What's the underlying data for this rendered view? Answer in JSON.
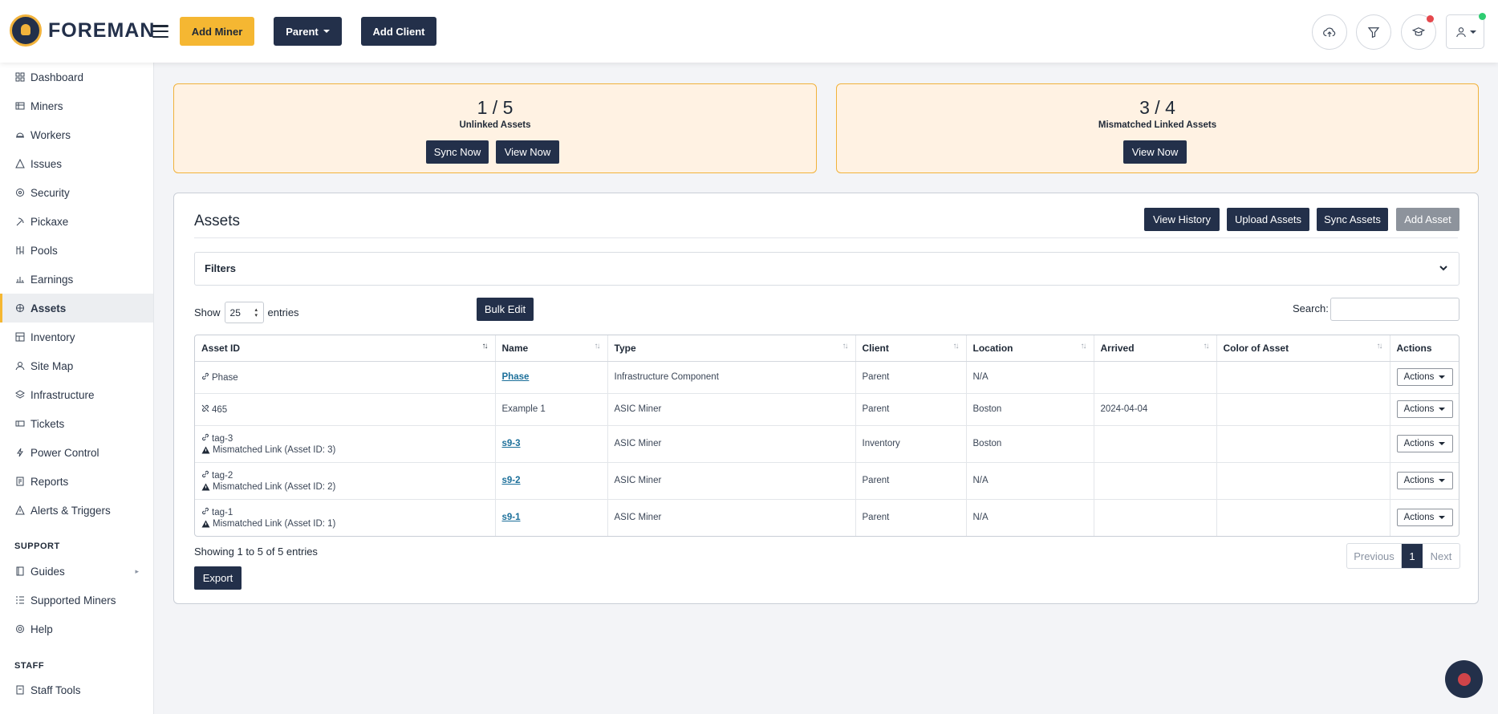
{
  "brand": {
    "name": "FOREMAN"
  },
  "header": {
    "add_miner": "Add Miner",
    "parent": "Parent",
    "add_client": "Add Client",
    "icons": [
      "cloud-upload-icon",
      "filter-icon",
      "graduation-cap-icon",
      "user-icon"
    ]
  },
  "sidebar": {
    "items": [
      {
        "label": "Dashboard",
        "icon": "dashboard-icon"
      },
      {
        "label": "Miners",
        "icon": "miners-icon"
      },
      {
        "label": "Workers",
        "icon": "workers-icon"
      },
      {
        "label": "Issues",
        "icon": "warning-icon"
      },
      {
        "label": "Security",
        "icon": "security-icon"
      },
      {
        "label": "Pickaxe",
        "icon": "pickaxe-icon"
      },
      {
        "label": "Pools",
        "icon": "pools-icon"
      },
      {
        "label": "Earnings",
        "icon": "earnings-icon"
      },
      {
        "label": "Assets",
        "icon": "assets-icon"
      },
      {
        "label": "Inventory",
        "icon": "inventory-icon"
      },
      {
        "label": "Site Map",
        "icon": "site-map-icon"
      },
      {
        "label": "Infrastructure",
        "icon": "layers-icon"
      },
      {
        "label": "Tickets",
        "icon": "ticket-icon"
      },
      {
        "label": "Power Control",
        "icon": "bolt-icon"
      },
      {
        "label": "Reports",
        "icon": "report-icon"
      },
      {
        "label": "Alerts & Triggers",
        "icon": "alert-icon"
      }
    ],
    "support_heading": "SUPPORT",
    "support_items": [
      {
        "label": "Guides",
        "icon": "book-icon"
      },
      {
        "label": "Supported Miners",
        "icon": "list-icon"
      },
      {
        "label": "Help",
        "icon": "help-icon"
      }
    ],
    "staff_heading": "STAFF",
    "staff_items": [
      {
        "label": "Staff Tools",
        "icon": "tools-icon"
      }
    ]
  },
  "summary": {
    "unlinked": {
      "value": "1 / 5",
      "label": "Unlinked Assets",
      "sync_btn": "Sync Now",
      "view_btn": "View Now"
    },
    "mismatched": {
      "value": "3 / 4",
      "label": "Mismatched Linked Assets",
      "view_btn": "View Now"
    }
  },
  "assets": {
    "title": "Assets",
    "view_history": "View History",
    "upload_assets": "Upload Assets",
    "sync_assets": "Sync Assets",
    "add_asset": "Add Asset",
    "filters_label": "Filters",
    "show_label": "Show",
    "entries_label": "entries",
    "page_size": "25",
    "bulk_edit": "Bulk Edit",
    "search_label": "Search:",
    "search_value": "",
    "columns": [
      "Asset ID",
      "Name",
      "Type",
      "Client",
      "Location",
      "Arrived",
      "Color of Asset",
      "Actions"
    ],
    "rows": [
      {
        "asset_id": "Phase",
        "warning": "",
        "name": "Phase",
        "name_link": true,
        "type": "Infrastructure Component",
        "client": "Parent",
        "location": "N/A",
        "arrived": "",
        "color": "",
        "actions": "Actions"
      },
      {
        "asset_id": "465",
        "warning": "",
        "name": "Example 1",
        "name_link": false,
        "type": "ASIC Miner",
        "client": "Parent",
        "location": "Boston",
        "arrived": "2024-04-04",
        "color": "",
        "actions": "Actions"
      },
      {
        "asset_id": "tag-3",
        "warning": "Mismatched Link (Asset ID: 3)",
        "name": "s9-3",
        "name_link": true,
        "type": "ASIC Miner",
        "client": "Inventory",
        "location": "Boston",
        "arrived": "",
        "color": "",
        "actions": "Actions"
      },
      {
        "asset_id": "tag-2",
        "warning": "Mismatched Link (Asset ID: 2)",
        "name": "s9-2",
        "name_link": true,
        "type": "ASIC Miner",
        "client": "Parent",
        "location": "N/A",
        "arrived": "",
        "color": "",
        "actions": "Actions"
      },
      {
        "asset_id": "tag-1",
        "warning": "Mismatched Link (Asset ID: 1)",
        "name": "s9-1",
        "name_link": true,
        "type": "ASIC Miner",
        "client": "Parent",
        "location": "N/A",
        "arrived": "",
        "color": "",
        "actions": "Actions"
      }
    ],
    "showing": "Showing 1 to 5 of 5 entries",
    "export": "Export",
    "pager": {
      "previous": "Previous",
      "current": "1",
      "next": "Next"
    }
  },
  "colors": {
    "accent": "#f5b732",
    "navy": "#23304a",
    "summary_bg": "#fff2e3",
    "link": "#1b6f9a",
    "notify_red": "#e5484d",
    "online_green": "#2ecc71"
  }
}
